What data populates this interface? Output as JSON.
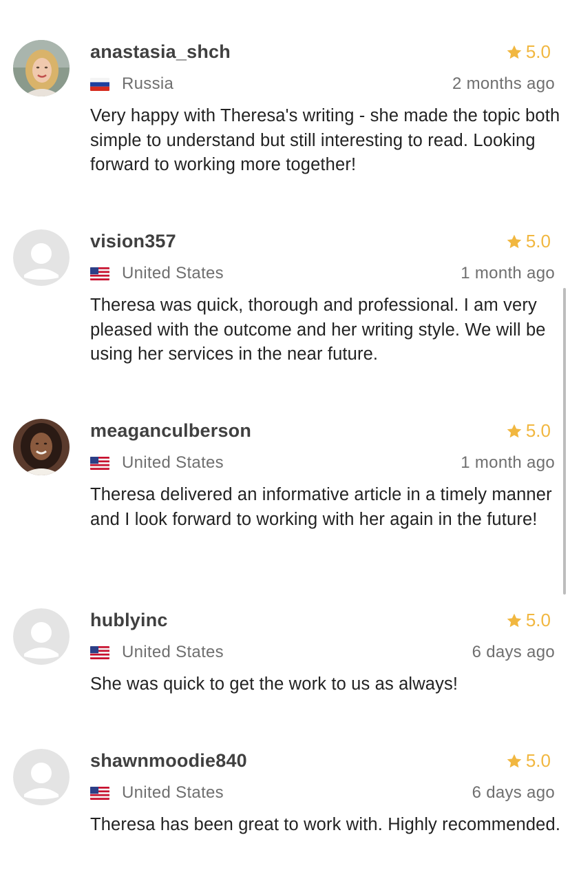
{
  "colors": {
    "star": "#f1b740",
    "username": "#404040",
    "secondary_text": "#6f6f6f",
    "body_text": "#222222",
    "placeholder_avatar": "#e4e4e4"
  },
  "reviews": [
    {
      "username": "anastasia_shch",
      "rating": "5.0",
      "country": "Russia",
      "flag_icon": "russia-flag-icon",
      "time": "2 months ago",
      "avatar": "photo",
      "comment": "Very happy with Theresa's writing - she made the topic both simple to understand but still interesting to read. Looking forward to working more together!"
    },
    {
      "username": "vision357",
      "rating": "5.0",
      "country": "United States",
      "flag_icon": "us-flag-icon",
      "time": "1 month ago",
      "avatar": "placeholder",
      "comment": "Theresa was quick, thorough and professional. I am very pleased with the outcome and her writing style. We will be using her services in the near future."
    },
    {
      "username": "meaganculberson",
      "rating": "5.0",
      "country": "United States",
      "flag_icon": "us-flag-icon",
      "time": "1 month ago",
      "avatar": "photo",
      "comment": "Theresa delivered an informative article in a timely manner and I look forward to working with her again in the future!"
    },
    {
      "username": "hublyinc",
      "rating": "5.0",
      "country": "United States",
      "flag_icon": "us-flag-icon",
      "time": "6 days ago",
      "avatar": "placeholder",
      "comment": "She was quick to get the work to us as always!"
    },
    {
      "username": "shawnmoodie840",
      "rating": "5.0",
      "country": "United States",
      "flag_icon": "us-flag-icon",
      "time": "6 days ago",
      "avatar": "placeholder",
      "comment": "Theresa has been great to work with. Highly recommended."
    }
  ]
}
